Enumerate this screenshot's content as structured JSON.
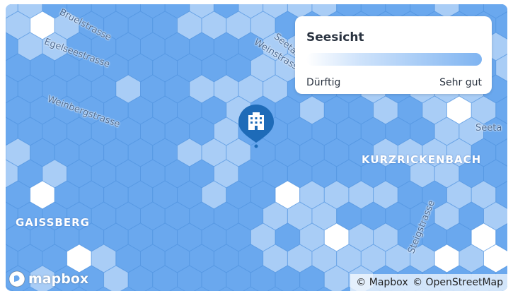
{
  "legend": {
    "title": "Seesicht",
    "low_label": "Dürftig",
    "high_label": "Sehr gut",
    "gradient_colors": [
      "#ffffff",
      "#cfe3fb",
      "#7fb4f1"
    ]
  },
  "labels": {
    "streets": [
      "Bruelstrasse",
      "Egelseestrasse",
      "Weinbergstrasse",
      "Seetal",
      "Weinstrasse",
      "Steigstrasse",
      "Seeta"
    ],
    "districts": [
      "KURZRICKENBACH",
      "GAISSBERG"
    ]
  },
  "marker": {
    "icon": "building-icon",
    "color": "#1e6bb8"
  },
  "map_colors": {
    "base": "#6aa8ee",
    "light": "#a9cdf6",
    "white": "#ffffff",
    "grid": "#4f91df"
  },
  "attribution": {
    "mapbox": "© Mapbox",
    "osm": "© OpenStreetMap"
  },
  "logo": {
    "text": "mapbox"
  }
}
